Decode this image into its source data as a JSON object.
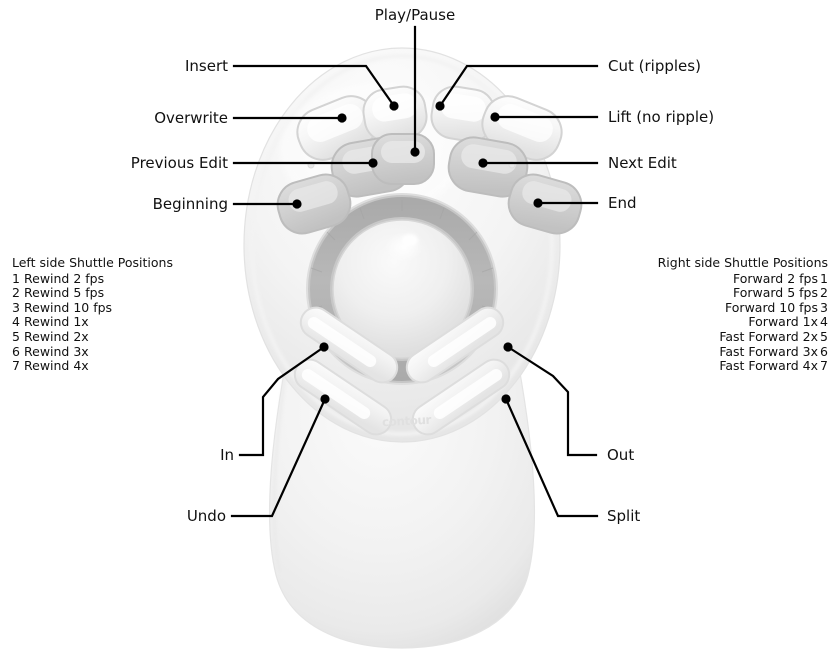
{
  "device": {
    "brand_text": "contour",
    "body_color": "#f1f1f1",
    "body_edge_color": "#e3e3e3",
    "jog_ring_color": "#b4b4b4",
    "knob_color": "#ececec",
    "button_color": "#eeeeee",
    "button_dark_color": "#cfcfcf"
  },
  "callouts": {
    "play_pause": "Play/Pause",
    "insert": "Insert",
    "overwrite": "Overwrite",
    "previous_edit": "Previous Edit",
    "beginning": "Beginning",
    "cut_ripples": "Cut (ripples)",
    "lift_no_ripple": "Lift (no ripple)",
    "next_edit": "Next Edit",
    "end": "End",
    "in": "In",
    "undo": "Undo",
    "out": "Out",
    "split": "Split"
  },
  "shuttle_left": {
    "title": "Left side Shuttle Positions",
    "rows": [
      {
        "num": "1",
        "label": "Rewind 2 fps"
      },
      {
        "num": "2",
        "label": "Rewind 5 fps"
      },
      {
        "num": "3",
        "label": "Rewind 10 fps"
      },
      {
        "num": "4",
        "label": "Rewind 1x"
      },
      {
        "num": "5",
        "label": "Rewind 2x"
      },
      {
        "num": "6",
        "label": "Rewind 3x"
      },
      {
        "num": "7",
        "label": "Rewind 4x"
      }
    ]
  },
  "shuttle_right": {
    "title": "Right side Shuttle Positions",
    "rows": [
      {
        "label": "Forward 2 fps",
        "num": "1"
      },
      {
        "label": "Forward 5 fps",
        "num": "2"
      },
      {
        "label": "Forward 10 fps",
        "num": "3"
      },
      {
        "label": "Forward 1x",
        "num": "4"
      },
      {
        "label": "Fast Forward 2x",
        "num": "5"
      },
      {
        "label": "Fast Forward 3x",
        "num": "6"
      },
      {
        "label": "Fast Forward 4x",
        "num": "7"
      }
    ]
  }
}
